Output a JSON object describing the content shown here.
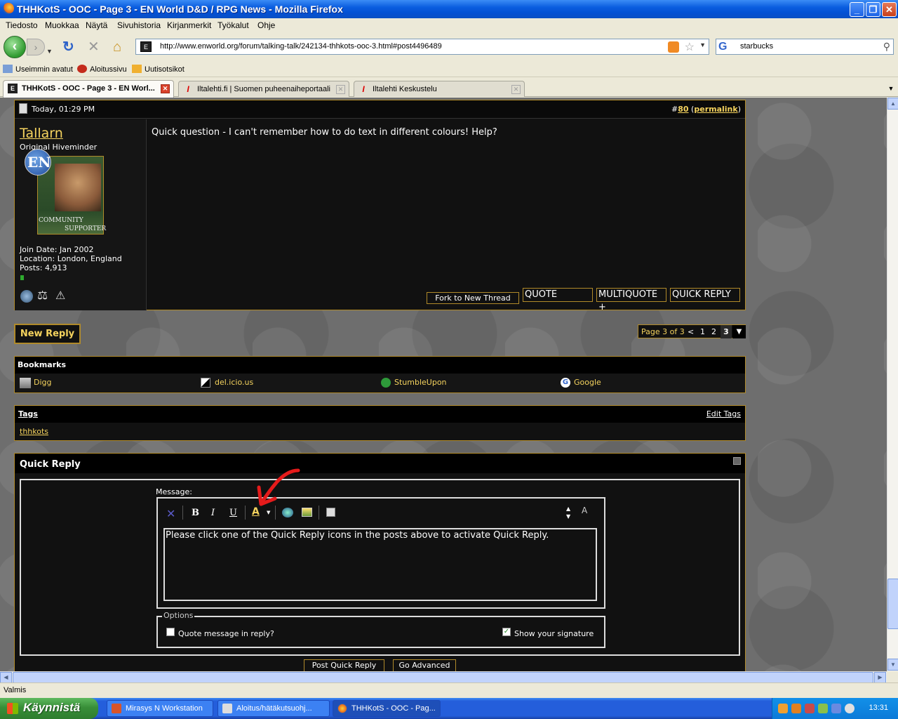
{
  "window": {
    "title": "THHKotS - OOC - Page 3 - EN World D&D / RPG News - Mozilla Firefox",
    "minimize_glyph": "_",
    "restore_glyph": "❐",
    "close_glyph": "✕"
  },
  "menu": [
    "Tiedosto",
    "Muokkaa",
    "Näytä",
    "Sivuhistoria",
    "Kirjanmerkit",
    "Työkalut",
    "Ohje"
  ],
  "navigation": {
    "url": "http://www.enworld.org/forum/talking-talk/242134-thhkots-ooc-3.html#post4496489",
    "search_value": "starbucks",
    "search_engine_glyph": "G",
    "favicon_glyph": "E"
  },
  "bookmarks": [
    "Useimmin avatut",
    "Aloitussivu",
    "Uutisotsikot"
  ],
  "tabs": [
    {
      "label": "THHKotS - OOC - Page 3 - EN Worl...",
      "active": true
    },
    {
      "label": "Iltalehti.fi | Suomen puheenaiheportaali",
      "active": false
    },
    {
      "label": "Iltalehti Keskustelu",
      "active": false
    }
  ],
  "post": {
    "date": "Today, 01:29 PM",
    "number_prefix": "#",
    "number": "80",
    "permalink": "permalink",
    "author": "Tallarn",
    "user_title": "Original Hiveminder",
    "avatar_caption_1": "COMMUNITY",
    "avatar_caption_2": "SUPPORTER",
    "badge_text": "EN",
    "join_date": "Join Date: Jan 2002",
    "location": "Location: London, England",
    "posts": "Posts: 4,913",
    "message": "Quick question - I can't remember how to do text in different colours! Help?",
    "buttons": {
      "fork": "Fork to New Thread",
      "quote": "QUOTE",
      "multiquote": "MULTIQUOTE +",
      "quick_reply": "QUICK REPLY"
    }
  },
  "thread_nav": {
    "new_reply": "New Reply",
    "page_label": "Page 3 of 3",
    "prev": "<",
    "pages": [
      "1",
      "2",
      "3"
    ],
    "current_page": "3"
  },
  "bookmarks_section": {
    "title": "Bookmarks",
    "items": [
      "Digg",
      "del.icio.us",
      "StumbleUpon",
      "Google"
    ]
  },
  "tags_section": {
    "title": "Tags",
    "edit": "Edit Tags",
    "tags": [
      "thhkots"
    ]
  },
  "quick_reply": {
    "title": "Quick Reply",
    "message_label": "Message:",
    "textarea_text": "Please click one of the Quick Reply icons in the posts above to activate Quick Reply.",
    "options_legend": "Options",
    "quote_option": "Quote message in reply?",
    "quote_checked": false,
    "signature_option": "Show your signature",
    "signature_checked": true,
    "post_button": "Post Quick Reply",
    "advanced_button": "Go Advanced",
    "toolbar": {
      "bold": "B",
      "italic": "I",
      "underline": "U",
      "font_color": "A",
      "size_toggle": "A"
    }
  },
  "status_bar": "Valmis",
  "taskbar": {
    "start": "Käynnistä",
    "tasks": [
      {
        "label": "Mirasys N Workstation",
        "active": false
      },
      {
        "label": "Aloitus/hätäkutsuohj...",
        "active": false
      },
      {
        "label": "THHKotS - OOC - Pag...",
        "active": true
      }
    ],
    "clock": "13:31"
  },
  "colors": {
    "accent_gold": "#f5d35e",
    "frame_gold": "#b08a2a",
    "arrow_red": "#e51b1b"
  }
}
